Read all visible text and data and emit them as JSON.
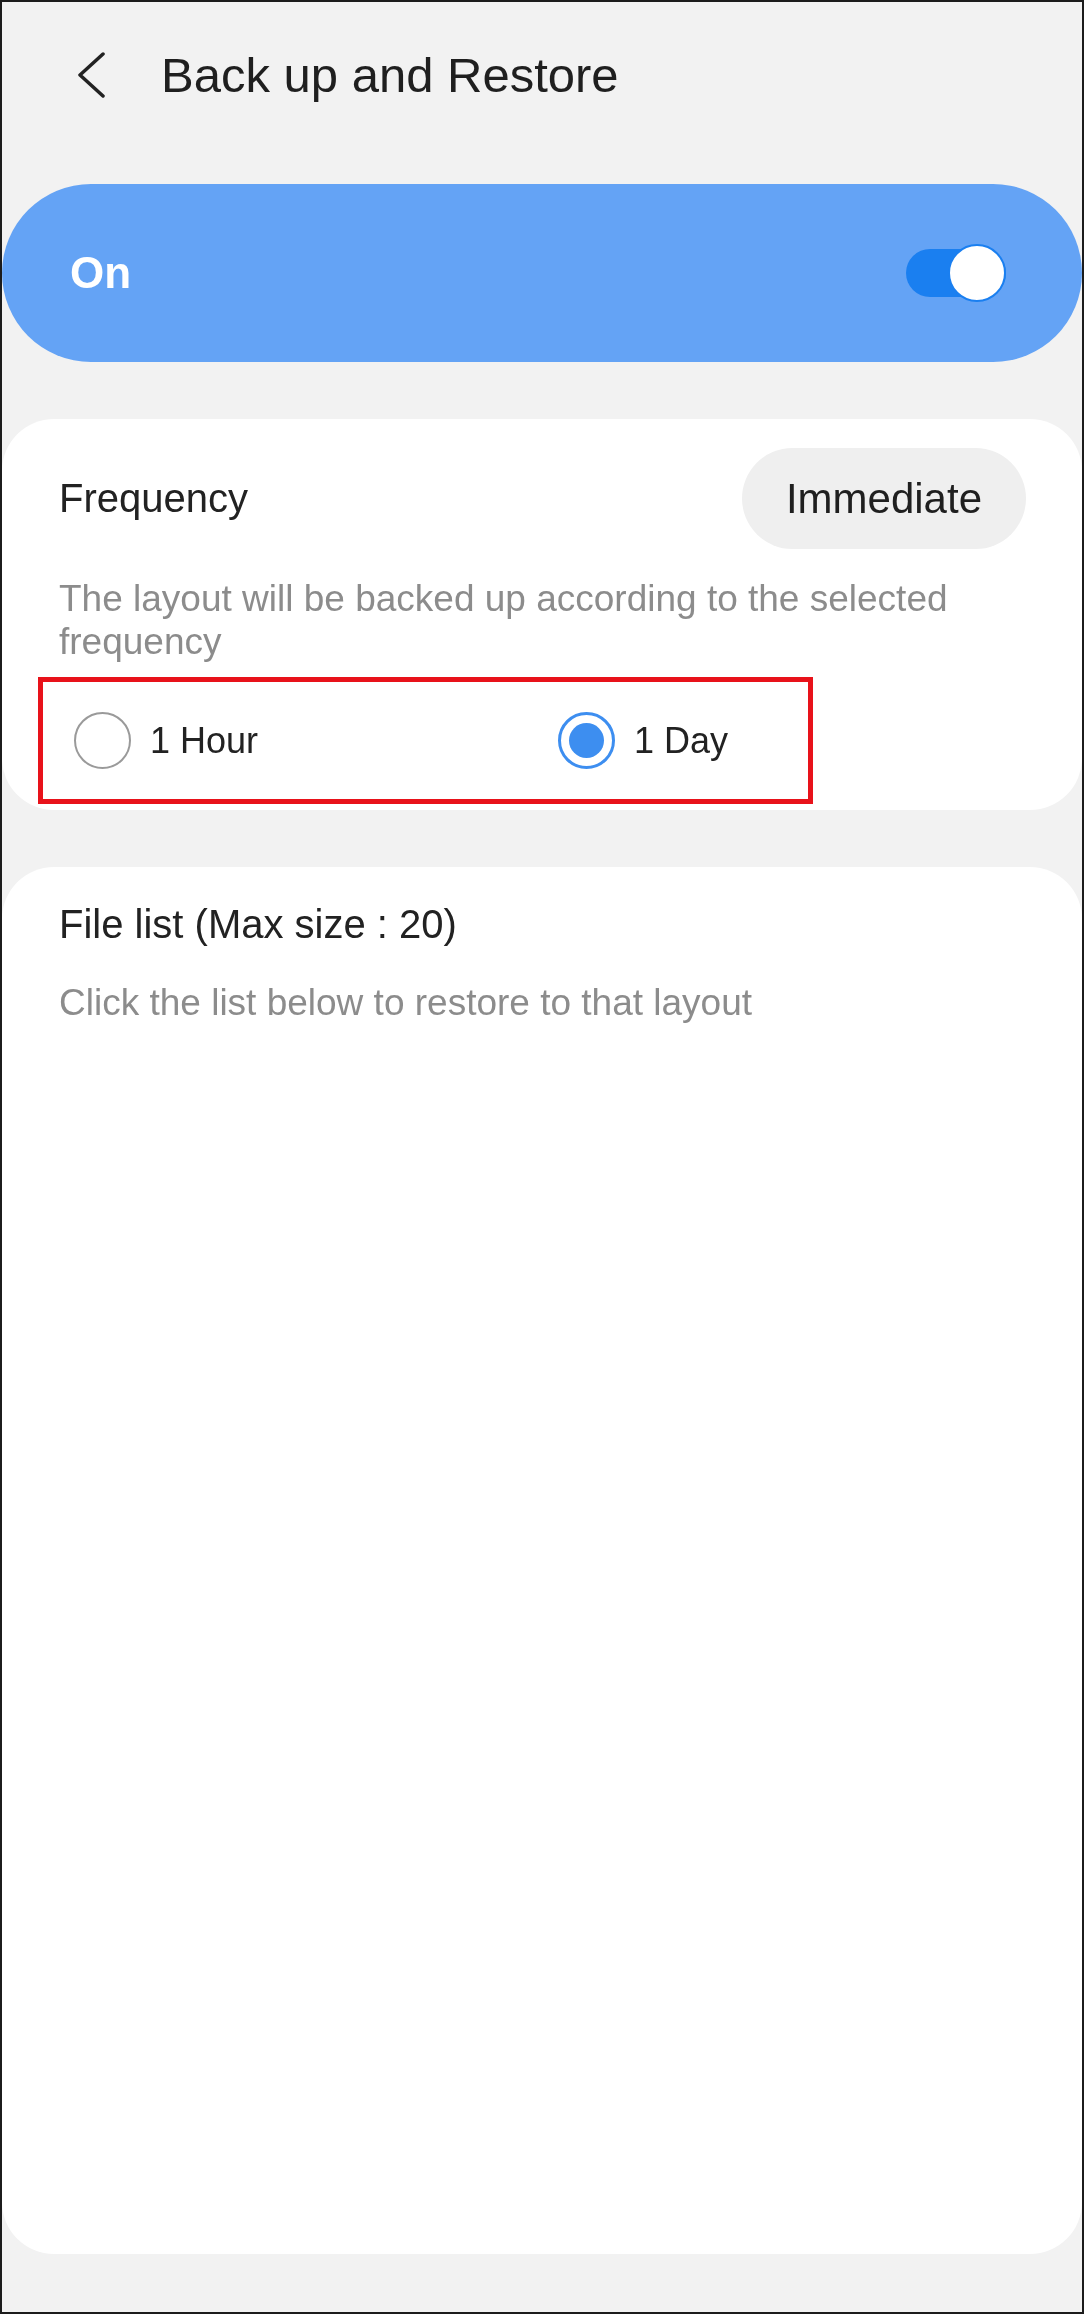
{
  "header": {
    "title": "Back up and Restore"
  },
  "master_switch": {
    "label": "On",
    "on": true
  },
  "frequency": {
    "label": "Frequency",
    "button": "Immediate",
    "description": "The layout will be backed up according to the selected frequency",
    "options": [
      {
        "label": "1 Hour",
        "selected": false
      },
      {
        "label": "1 Day",
        "selected": true
      }
    ]
  },
  "file_list": {
    "title": "File list (Max size : 20)",
    "hint": "Click the list below to restore to that layout"
  }
}
